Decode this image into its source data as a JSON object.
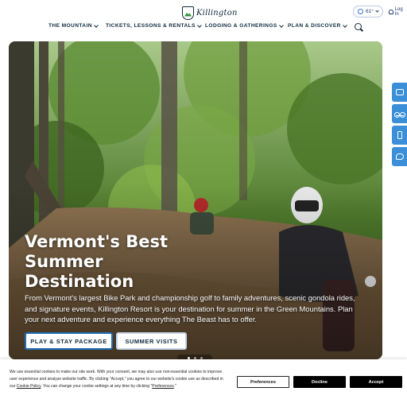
{
  "header": {
    "logo_text": "Killington",
    "weather": "61°",
    "login_label": "Log In"
  },
  "nav": [
    {
      "label": "THE MOUNTAIN"
    },
    {
      "label": "TICKETS, LESSONS & RENTALS"
    },
    {
      "label": "LODGING & GATHERINGS"
    },
    {
      "label": "PLAN & DISCOVER"
    }
  ],
  "hero": {
    "title": "Vermont's Best Summer Destination",
    "text": "From Vermont's largest Bike Park and championship golf to family adventures, scenic gondola rides, and signature events, Killington Resort is your destination for summer in the Green Mountains. Plan your next adventure and experience everything The Beast has to offer.",
    "primary_button": "PLAY & STAY PACKAGE",
    "secondary_button": "SUMMER VISITS",
    "slides_total": 3,
    "slide_active": 1
  },
  "side_tabs": [
    "mail-icon",
    "bike-icon",
    "phone-icon",
    "chat-icon"
  ],
  "cookie": {
    "line1": "We use essential cookies to make our site work. With your consent, we may also use non-essential cookies to improve",
    "line2": "user experience and analyze website traffic. By clicking \"Accept,\" you agree to our website's cookie use as described in",
    "line3_pre": "our",
    "policy_link": "Cookie Policy",
    "line3_mid": ". You can change your cookie settings at any time by clicking \"",
    "pref_link": "Preferences",
    "line3_post": ".\"",
    "preferences_button": "Preferences",
    "decline_button": "Decline",
    "accept_button": "Accept"
  },
  "colors": {
    "brand_navy": "#0f2a3d",
    "accent_blue": "#3a8fd8",
    "button_border": "#1f6fb5"
  }
}
